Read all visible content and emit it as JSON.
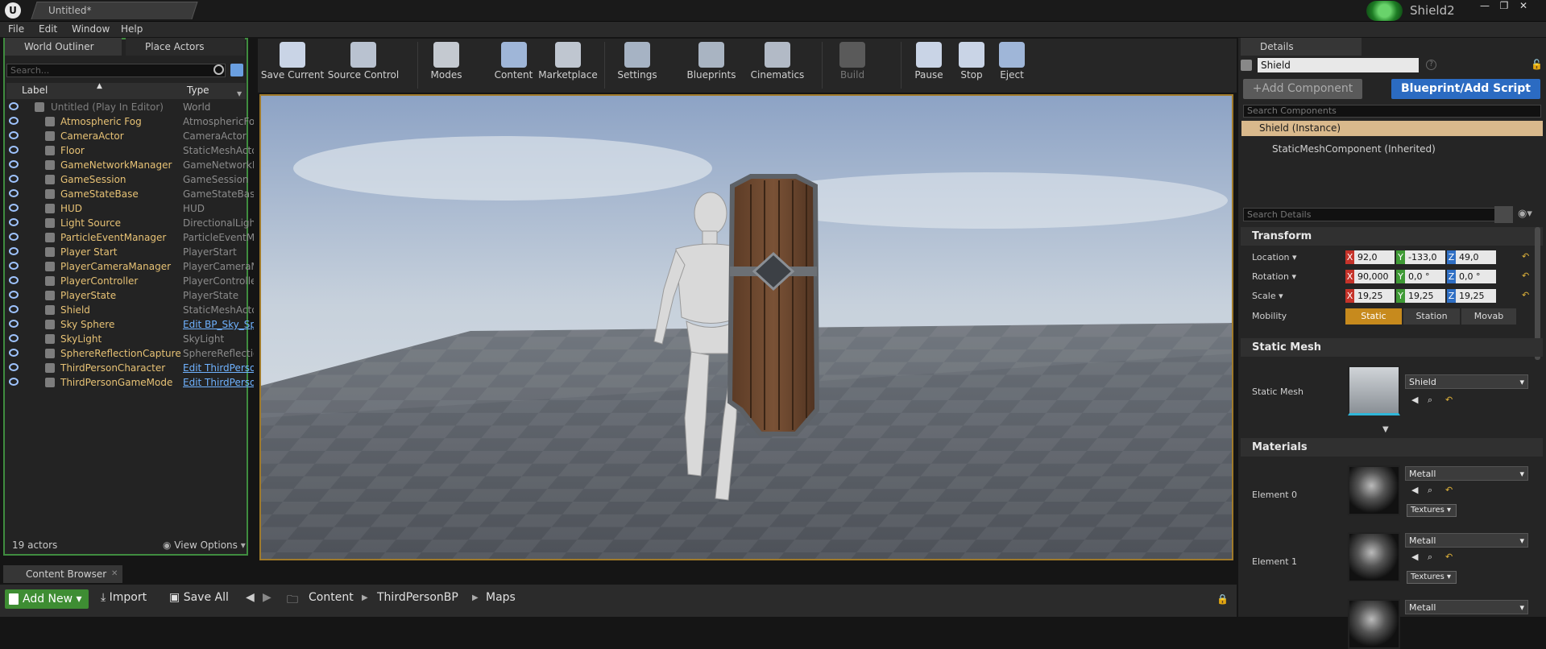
{
  "window": {
    "tab_title": "Untitled*",
    "project_name": "Shield2",
    "controls": [
      "—",
      "❐",
      "✕"
    ]
  },
  "menu": [
    "File",
    "Edit",
    "Window",
    "Help"
  ],
  "outliner": {
    "tabs": [
      "World Outliner",
      "Place Actors"
    ],
    "search_placeholder": "Search...",
    "columns": {
      "label": "Label",
      "type": "Type"
    },
    "rows": [
      {
        "label": "Untitled (Play In Editor)",
        "type": "World"
      },
      {
        "label": "Atmospheric Fog",
        "type": "AtmosphericFog"
      },
      {
        "label": "CameraActor",
        "type": "CameraActor"
      },
      {
        "label": "Floor",
        "type": "StaticMeshActor"
      },
      {
        "label": "GameNetworkManager",
        "type": "GameNetworkManager"
      },
      {
        "label": "GameSession",
        "type": "GameSession"
      },
      {
        "label": "GameStateBase",
        "type": "GameStateBase"
      },
      {
        "label": "HUD",
        "type": "HUD"
      },
      {
        "label": "Light Source",
        "type": "DirectionalLight"
      },
      {
        "label": "ParticleEventManager",
        "type": "ParticleEventManager"
      },
      {
        "label": "Player Start",
        "type": "PlayerStart"
      },
      {
        "label": "PlayerCameraManager",
        "type": "PlayerCameraManager"
      },
      {
        "label": "PlayerController",
        "type": "PlayerController"
      },
      {
        "label": "PlayerState",
        "type": "PlayerState"
      },
      {
        "label": "Shield",
        "type": "StaticMeshActor"
      },
      {
        "label": "Sky Sphere",
        "type": "Edit BP_Sky_Sphere"
      },
      {
        "label": "SkyLight",
        "type": "SkyLight"
      },
      {
        "label": "SphereReflectionCapture",
        "type": "SphereReflectionCapture"
      },
      {
        "label": "ThirdPersonCharacter",
        "type": "Edit ThirdPersonCharacter"
      },
      {
        "label": "ThirdPersonGameMode",
        "type": "Edit ThirdPersonGameMode"
      }
    ],
    "actor_count": "19 actors",
    "view_options": "View Options"
  },
  "toolbar": [
    {
      "label": "Save Current",
      "icon": "save-icon"
    },
    {
      "label": "Source Control",
      "icon": "source-control-icon"
    },
    {
      "label": "Modes",
      "icon": "modes-icon"
    },
    {
      "label": "Content",
      "icon": "content-icon"
    },
    {
      "label": "Marketplace",
      "icon": "marketplace-icon"
    },
    {
      "label": "Settings",
      "icon": "settings-icon"
    },
    {
      "label": "Blueprints",
      "icon": "blueprints-icon"
    },
    {
      "label": "Cinematics",
      "icon": "cinematics-icon"
    },
    {
      "label": "Build",
      "icon": "build-icon"
    },
    {
      "label": "Pause",
      "icon": "pause-icon"
    },
    {
      "label": "Stop",
      "icon": "stop-icon"
    },
    {
      "label": "Eject",
      "icon": "eject-icon"
    }
  ],
  "content_browser": {
    "tab": "Content Browser",
    "add_new": "Add New",
    "import": "Import",
    "save_all": "Save All",
    "path": [
      "Content",
      "ThirdPersonBP",
      "Maps"
    ]
  },
  "details": {
    "tab": "Details",
    "actor_name": "Shield",
    "add_component": "+Add Component",
    "blueprint_button": "Blueprint/Add Script",
    "search_components_placeholder": "Search Components",
    "instance": "Shield (Instance)",
    "component": "StaticMeshComponent (Inherited)",
    "search_details_placeholder": "Search Details",
    "transform": {
      "title": "Transform",
      "location_label": "Location",
      "rotation_label": "Rotation",
      "scale_label": "Scale",
      "mobility_label": "Mobility",
      "location": {
        "x": "92,0",
        "y": "-133,0",
        "z": "49,0"
      },
      "rotation": {
        "x": "90,000",
        "y": "0,0 °",
        "z": "0,0 °"
      },
      "scale": {
        "x": "19,25",
        "y": "19,25",
        "z": "19,25"
      },
      "mobility": [
        "Static",
        "Station",
        "Movab"
      ]
    },
    "static_mesh": {
      "title": "Static Mesh",
      "label": "Static Mesh",
      "value": "Shield"
    },
    "materials": {
      "title": "Materials",
      "elements": [
        {
          "label": "Element 0",
          "value": "Metall",
          "textures": "Textures"
        },
        {
          "label": "Element 1",
          "value": "Metall",
          "textures": "Textures"
        },
        {
          "label": "",
          "value": "Metall",
          "textures": ""
        }
      ]
    }
  },
  "colors": {
    "accent_green": "#3e8d33",
    "blueprint_blue": "#2b6bc2",
    "selection_orange": "#a07a2a",
    "label_yellow": "#e7c275",
    "link_blue": "#6fb2ff"
  }
}
